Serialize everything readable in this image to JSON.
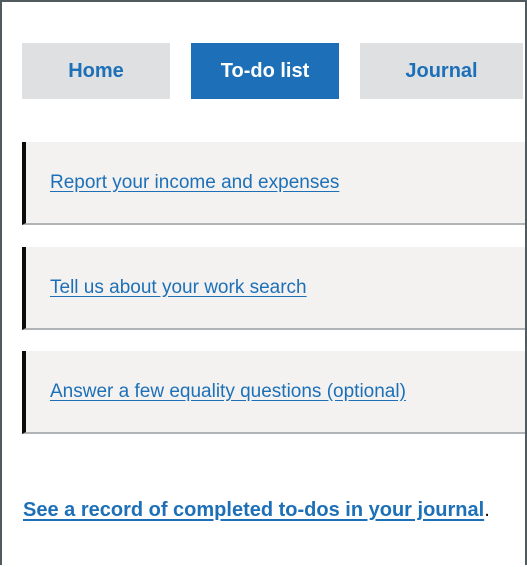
{
  "tabs": [
    {
      "label": "Home",
      "active": false
    },
    {
      "label": "To-do list",
      "active": true
    },
    {
      "label": "Journal",
      "active": false
    }
  ],
  "todos": [
    {
      "label": "Report your income and expenses"
    },
    {
      "label": "Tell us about your work search"
    },
    {
      "label": "Answer a few equality questions (optional)"
    }
  ],
  "footer": {
    "link_text": "See a record of completed to-dos in your journal",
    "suffix": "."
  },
  "colors": {
    "link": "#1d70b8",
    "active_tab_bg": "#1d70b8",
    "inactive_tab_bg": "#dee0e2",
    "item_bg": "#f3f2f1",
    "item_border": "#0b0c0c",
    "text": "#0b0c0c"
  }
}
